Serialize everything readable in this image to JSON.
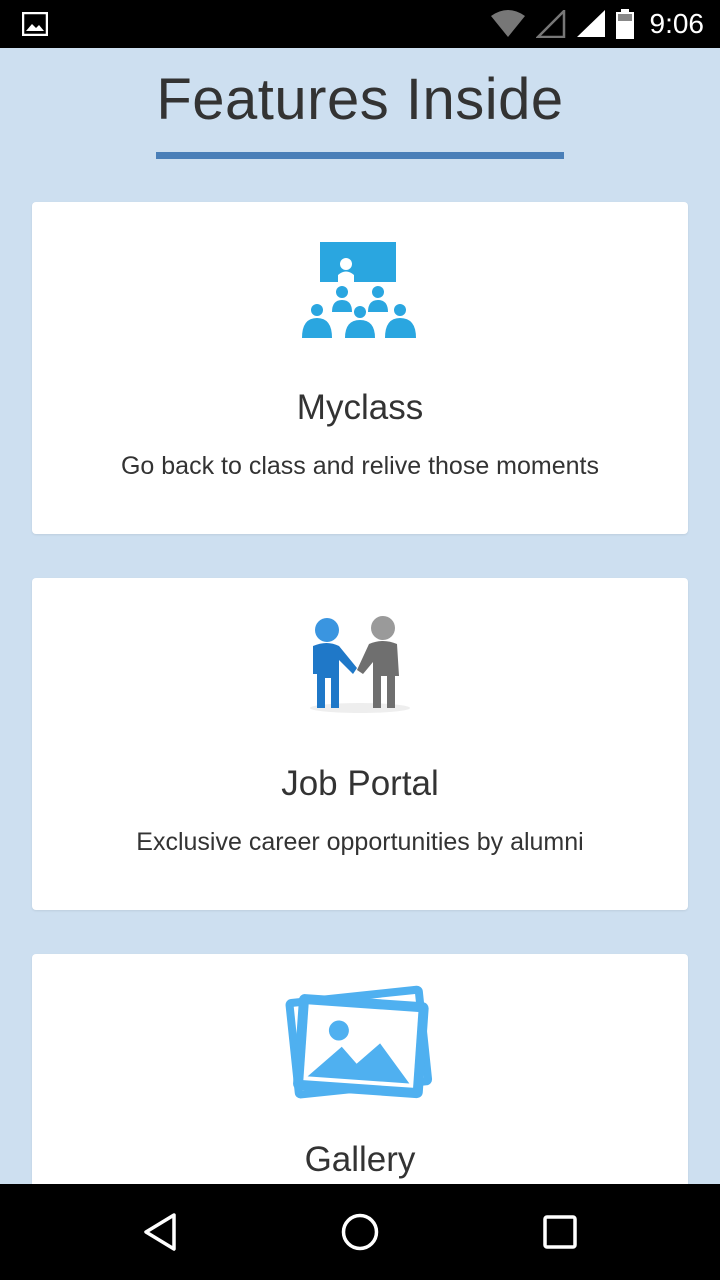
{
  "status_bar": {
    "time": "9:06",
    "icons": [
      "image-notification-icon",
      "wifi-icon",
      "signal-icon",
      "signal-icon",
      "battery-icon"
    ]
  },
  "page": {
    "title": "Features Inside"
  },
  "features": [
    {
      "icon": "classroom-icon",
      "title": "Myclass",
      "description": "Go back to class and relive those moments"
    },
    {
      "icon": "handshake-icon",
      "title": "Job Portal",
      "description": "Exclusive career opportunities by alumni"
    },
    {
      "icon": "gallery-icon",
      "title": "Gallery",
      "description": ""
    }
  ],
  "colors": {
    "background": "#cddff0",
    "accent": "#4a7fb8",
    "icon_blue": "#2aa6e0"
  },
  "nav_bar": {
    "buttons": [
      "back-icon",
      "home-icon",
      "recents-icon"
    ]
  }
}
